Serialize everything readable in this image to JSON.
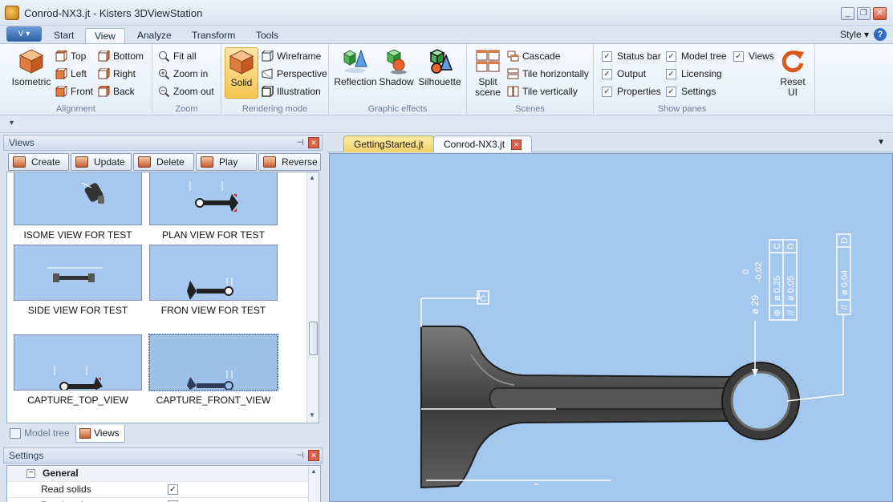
{
  "window": {
    "title": "Conrod-NX3.jt - Kisters 3DViewStation",
    "app_icon": "3dviewstation-logo-icon",
    "controls": [
      "minimize-icon",
      "restore-icon",
      "close-icon"
    ]
  },
  "menubar": {
    "app_button": "V",
    "tabs": [
      "Start",
      "View",
      "Analyze",
      "Transform",
      "Tools"
    ],
    "active_tab": "View",
    "style_label": "Style",
    "help_glyph": "?"
  },
  "ribbon": {
    "alignment": {
      "label": "Alignment",
      "isometric": "Isometric",
      "top": "Top",
      "left": "Left",
      "front": "Front",
      "bottom": "Bottom",
      "right": "Right",
      "back": "Back"
    },
    "zoom": {
      "label": "Zoom",
      "fit_all": "Fit all",
      "zoom_in": "Zoom in",
      "zoom_out": "Zoom out"
    },
    "rendering": {
      "label": "Rendering mode",
      "solid": "Solid",
      "wireframe": "Wireframe",
      "perspective": "Perspective",
      "illustration": "Illustration"
    },
    "effects": {
      "label": "Graphic effects",
      "reflection": "Reflection",
      "shadow": "Shadow",
      "silhouette": "Silhouette"
    },
    "scenes": {
      "label": "Scenes",
      "split_line1": "Split",
      "split_line2": "scene",
      "cascade": "Cascade",
      "tile_h": "Tile horizontally",
      "tile_v": "Tile vertically"
    },
    "panes": {
      "label": "Show panes",
      "status_bar": "Status bar",
      "output": "Output",
      "properties": "Properties",
      "model_tree": "Model tree",
      "licensing": "Licensing",
      "settings": "Settings",
      "views": "Views",
      "checked": "✓"
    },
    "reset_line1": "Reset",
    "reset_line2": "UI"
  },
  "qat_glyph": "▾",
  "views_pane": {
    "title": "Views",
    "pin": "⊣",
    "close": "✕",
    "buttons": {
      "create": "Create",
      "update": "Update",
      "delete": "Delete",
      "play": "Play",
      "reverse": "Reverse ..."
    },
    "thumbnails": [
      {
        "caption": "ISOME VIEW FOR TEST"
      },
      {
        "caption": "PLAN VIEW FOR TEST"
      },
      {
        "caption": "SIDE VIEW FOR TEST"
      },
      {
        "caption": "FRON VIEW FOR TEST"
      },
      {
        "caption": "CAPTURE_TOP_VIEW"
      },
      {
        "caption": "CAPTURE_FRONT_VIEW"
      }
    ],
    "scroll_up": "▲",
    "scroll_down": "▼",
    "tabs": {
      "model_tree": "Model tree",
      "views": "Views"
    }
  },
  "settings_pane": {
    "title": "Settings",
    "group": "General",
    "minus": "−",
    "rows": [
      {
        "key": "Read solids",
        "checked": "✓"
      },
      {
        "key": "Read surfaces",
        "checked": "✓"
      }
    ]
  },
  "viewer": {
    "tabs": [
      {
        "label": "GettingStarted.jt"
      },
      {
        "label": "Conrod-NX3.jt"
      }
    ],
    "close": "✕",
    "dropdown": "▼",
    "annotations": {
      "datum_c": "C",
      "dim_main": "ø 29",
      "dim_tol_top": "0",
      "dim_tol_bottom": "-0,02",
      "fcf1_row1": "C",
      "fcf1_row1_val": "ø 0,25",
      "fcf1_row2": "D",
      "fcf1_row2_val": "ø 0,05",
      "fcf2_datum": "D",
      "fcf2_val": "ø 0,04"
    },
    "colors": {
      "background": "#a4c7ee",
      "part": "#4a4a4a",
      "annotation": "#ffffff"
    }
  }
}
